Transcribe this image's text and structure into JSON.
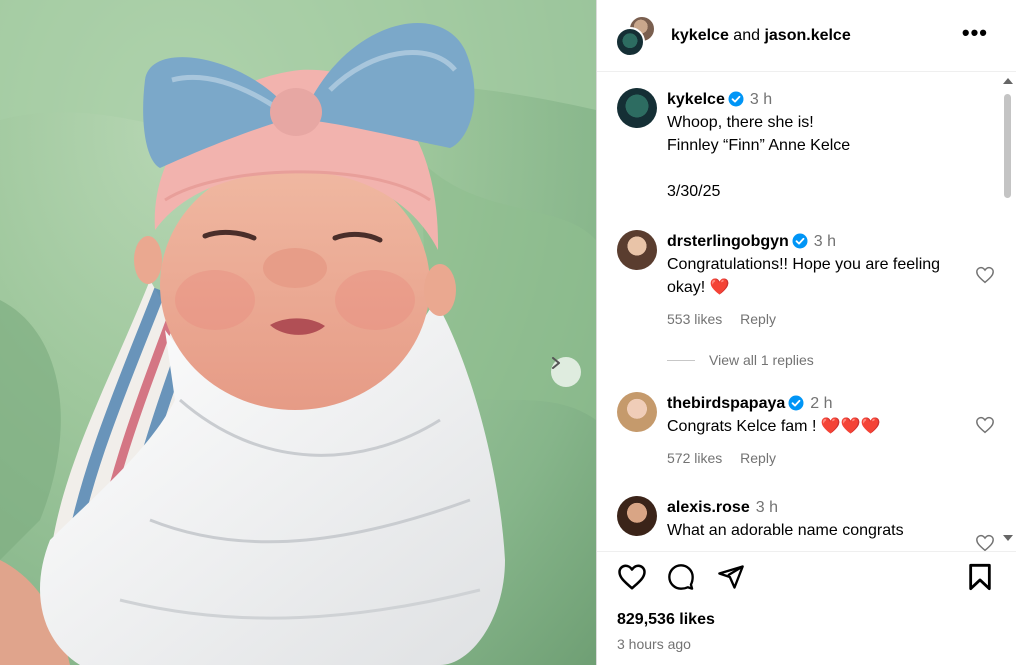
{
  "header": {
    "user1": "kykelce",
    "conjunction": "and",
    "user2": "jason.kelce",
    "more_label": "•••"
  },
  "caption": {
    "username": "kykelce",
    "time": "3 h",
    "text": "Whoop, there she is!\nFinnley “Finn” Anne Kelce\n\n3/30/25"
  },
  "comments": [
    {
      "username": "drsterlingobgyn",
      "time": "3 h",
      "text": "Congratulations!! Hope you are feeling okay! ❤️",
      "likes": "553 likes",
      "reply": "Reply"
    },
    {
      "username": "thebirdspapaya",
      "time": "2 h",
      "text": "Congrats Kelce fam ! ❤️❤️❤️",
      "likes": "572 likes",
      "reply": "Reply"
    },
    {
      "username": "alexis.rose",
      "time": "3 h",
      "text": "What an adorable name congrats"
    }
  ],
  "view_replies": "View all 1 replies",
  "post": {
    "likes": "829,536 likes",
    "time_ago": "3 hours ago"
  },
  "colors": {
    "verified": "#0095f6",
    "heart_red": "#e0102a",
    "muted_text": "#737373"
  }
}
